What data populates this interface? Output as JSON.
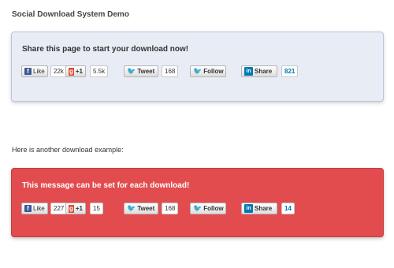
{
  "page": {
    "title": "Social Download System Demo",
    "intro2": "Here is another download example:"
  },
  "panels": [
    {
      "message": "Share this page to start your download now!",
      "facebook": {
        "label": "Like",
        "count": "22k"
      },
      "gplus": {
        "label": "+1",
        "count": "5.5k"
      },
      "twitter": {
        "label": "Tweet",
        "count": "168"
      },
      "follow": {
        "label": "Follow"
      },
      "linkedin": {
        "label": "Share",
        "count": "821"
      }
    },
    {
      "message": "This message can be set for each download!",
      "facebook": {
        "label": "Like",
        "count": "227"
      },
      "gplus": {
        "label": "+1",
        "count": "15"
      },
      "twitter": {
        "label": "Tweet",
        "count": "168"
      },
      "follow": {
        "label": "Follow"
      },
      "linkedin": {
        "label": "Share",
        "count": "14"
      }
    }
  ],
  "colors": {
    "panel_blue_bg": "#e8ecf5",
    "panel_red_bg": "#e24c4f",
    "facebook": "#3b5998",
    "twitter": "#2aa9e0",
    "linkedin": "#0077b5",
    "gplus": "#dd4b39"
  },
  "icons": {
    "facebook": "facebook-icon",
    "twitter": "twitter-bird-icon",
    "linkedin": "linkedin-icon",
    "gplus": "google-plus-icon"
  }
}
